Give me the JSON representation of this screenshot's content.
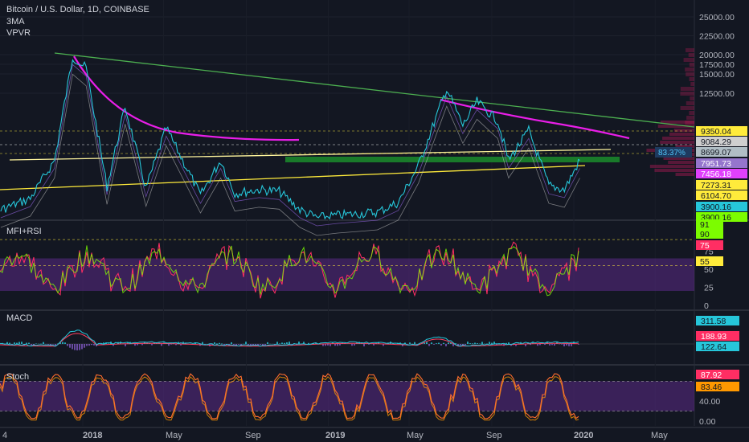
{
  "legend": {
    "symbol_line": "Bitcoin / U.S. Dollar, 1D, COINBASE",
    "indicator_1": "3MA",
    "indicator_2": "VPVR"
  },
  "panes": {
    "mfi_title": "MFI+RSI",
    "macd_title": "MACD",
    "stoch_title": "Stoch"
  },
  "colors": {
    "background": "#131722",
    "price": "#26c6da",
    "trend_top": "#4caf50",
    "trend_arc": "#e91ee8",
    "support": "#ffeb3b",
    "zone": "#1b8c2b",
    "rsi": "#7cfc00",
    "mfi": "#ff2e63",
    "band": "#5b2a86",
    "macd": "#26c6da",
    "signal": "#ff4060",
    "stoch": "#ff6d2e"
  },
  "chart_data": [
    {
      "type": "line",
      "title": "Bitcoin / U.S. Dollar, 1D, COINBASE",
      "ylim": [
        0,
        26500
      ],
      "yticks": [
        "25000.00",
        "22500.00",
        "20000.00",
        "17500.00",
        "15000.00",
        "12500.00"
      ],
      "xticks": [
        "4",
        "2018",
        "May",
        "Sep",
        "2019",
        "May",
        "Sep",
        "2020",
        "May"
      ],
      "series": [
        {
          "x": [
            "2017-09-01",
            "2017-10-15",
            "2017-11-20",
            "2017-12-17",
            "2018-01-06",
            "2018-02-06",
            "2018-03-05",
            "2018-04-05",
            "2018-05-05",
            "2018-06-25",
            "2018-07-25",
            "2018-08-15",
            "2018-09-20",
            "2018-10-20",
            "2018-11-20",
            "2018-12-15",
            "2019-01-15",
            "2019-02-15",
            "2019-03-15",
            "2019-04-15",
            "2019-05-15",
            "2019-06-26",
            "2019-07-20",
            "2019-08-10",
            "2019-09-10",
            "2019-09-26",
            "2019-10-26",
            "2019-11-25",
            "2019-12-18",
            "2020-01-10"
          ],
          "values": [
            4300,
            5700,
            8200,
            19500,
            16500,
            7000,
            11400,
            6800,
            9600,
            6100,
            8200,
            6300,
            6700,
            6500,
            4300,
            3300,
            3600,
            3800,
            4000,
            5200,
            8000,
            13100,
            9800,
            11800,
            10200,
            8200,
            9400,
            7100,
            6700,
            8200
          ]
        }
      ],
      "tags": [
        {
          "label": "9350.04",
          "value": 9350,
          "bg": "#ffeb3b",
          "fg": "#131722"
        },
        {
          "label": "9084.29",
          "value": 9084,
          "bg": "#cfcfcf",
          "fg": "#131722"
        },
        {
          "label": "8699.07",
          "value": 8699,
          "bg": "#b0bec5",
          "fg": "#131722"
        },
        {
          "label": "7951.73",
          "value": 7952,
          "bg": "#9575cd",
          "fg": "#ffffff"
        },
        {
          "label": "7456.18",
          "value": 7456,
          "bg": "#e040fb",
          "fg": "#ffffff"
        },
        {
          "label": "7273.31",
          "value": 7273,
          "bg": "#ffeb3b",
          "fg": "#131722"
        },
        {
          "label": "6104.70",
          "value": 6105,
          "bg": "#ffeb3b",
          "fg": "#131722"
        },
        {
          "label": "3900.16",
          "value": 3900,
          "bg": "#26c6da",
          "fg": "#131722"
        },
        {
          "label": "3900.16",
          "value": 3900,
          "bg": "#7cfc00",
          "fg": "#131722"
        }
      ],
      "vpvr_badge": "83.37%"
    },
    {
      "type": "line",
      "title": "MFI+RSI",
      "ylim": [
        0,
        100
      ],
      "yticks": [
        "75",
        "50",
        "25",
        "0"
      ],
      "tags": [
        {
          "label": "91",
          "value": 91,
          "bg": "#7cfc00",
          "fg": "#131722"
        },
        {
          "label": "90",
          "value": 90,
          "bg": "#7cfc00",
          "fg": "#131722"
        },
        {
          "label": "75",
          "value": 75,
          "bg": "#ff2e63",
          "fg": "#ffffff"
        },
        {
          "label": "55",
          "value": 55,
          "bg": "#ffeb3b",
          "fg": "#131722"
        }
      ]
    },
    {
      "type": "line",
      "title": "MACD",
      "tags": [
        {
          "label": "311.58",
          "value": 311.58,
          "bg": "#26c6da",
          "fg": "#131722"
        },
        {
          "label": "188.93",
          "value": 188.93,
          "bg": "#ff2e63",
          "fg": "#ffffff"
        },
        {
          "label": "122.64",
          "value": 122.64,
          "bg": "#26c6da",
          "fg": "#131722"
        }
      ]
    },
    {
      "type": "line",
      "title": "Stoch",
      "ylim": [
        0,
        100
      ],
      "yticks": [
        "40.00",
        "0.00"
      ],
      "tags": [
        {
          "label": "87.92",
          "value": 87.92,
          "bg": "#ff2e63",
          "fg": "#ffffff"
        },
        {
          "label": "83.46",
          "value": 83.46,
          "bg": "#ff9800",
          "fg": "#131722"
        }
      ]
    }
  ]
}
